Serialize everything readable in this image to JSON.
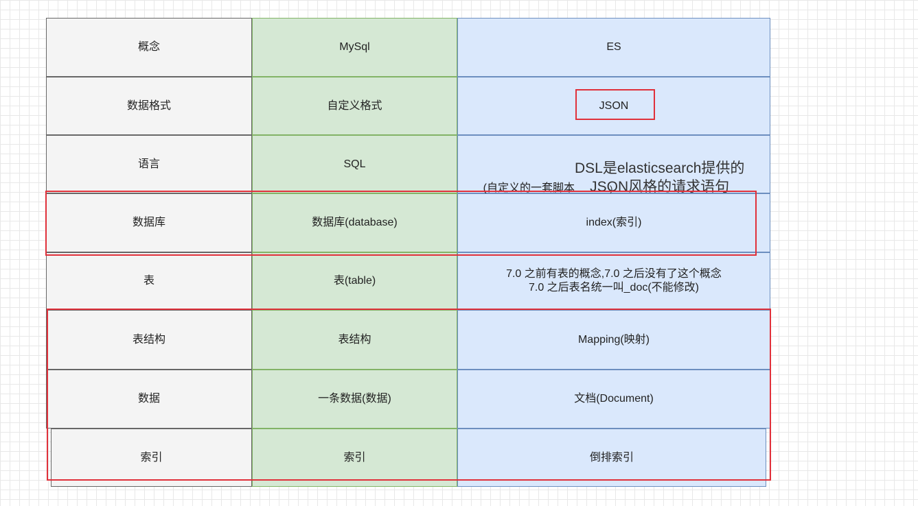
{
  "header": {
    "concept": "概念",
    "mysql": "MySql",
    "es": "ES"
  },
  "rows": [
    {
      "concept": "数据格式",
      "mysql": "自定义格式",
      "es": "JSON"
    },
    {
      "concept": "语言",
      "mysql": "SQL",
      "es_prefix": "(自定义的一套脚本",
      "es_main": "DSL是elasticsearch提供的\nJSON风格的请求语句",
      "es_suffix": ")"
    },
    {
      "concept": "数据库",
      "mysql": "数据库(database)",
      "es": "index(索引)"
    },
    {
      "concept": "表",
      "mysql": "表(table)",
      "es": "7.0 之前有表的概念,7.0 之后没有了这个概念\n7.0 之后表名统一叫_doc(不能修改)"
    },
    {
      "concept": "表结构",
      "mysql": "表结构",
      "es": "Mapping(映射)"
    },
    {
      "concept": "数据",
      "mysql": "一条数据(数据)",
      "es": "文档(Document)"
    },
    {
      "concept": "索引",
      "mysql": "索引",
      "es": "倒排索引"
    }
  ],
  "colors": {
    "concept_fill": "#f4f4f4",
    "mysql_fill": "#d5e8d4",
    "es_fill": "#dae8fc",
    "highlight": "#e0303a"
  }
}
